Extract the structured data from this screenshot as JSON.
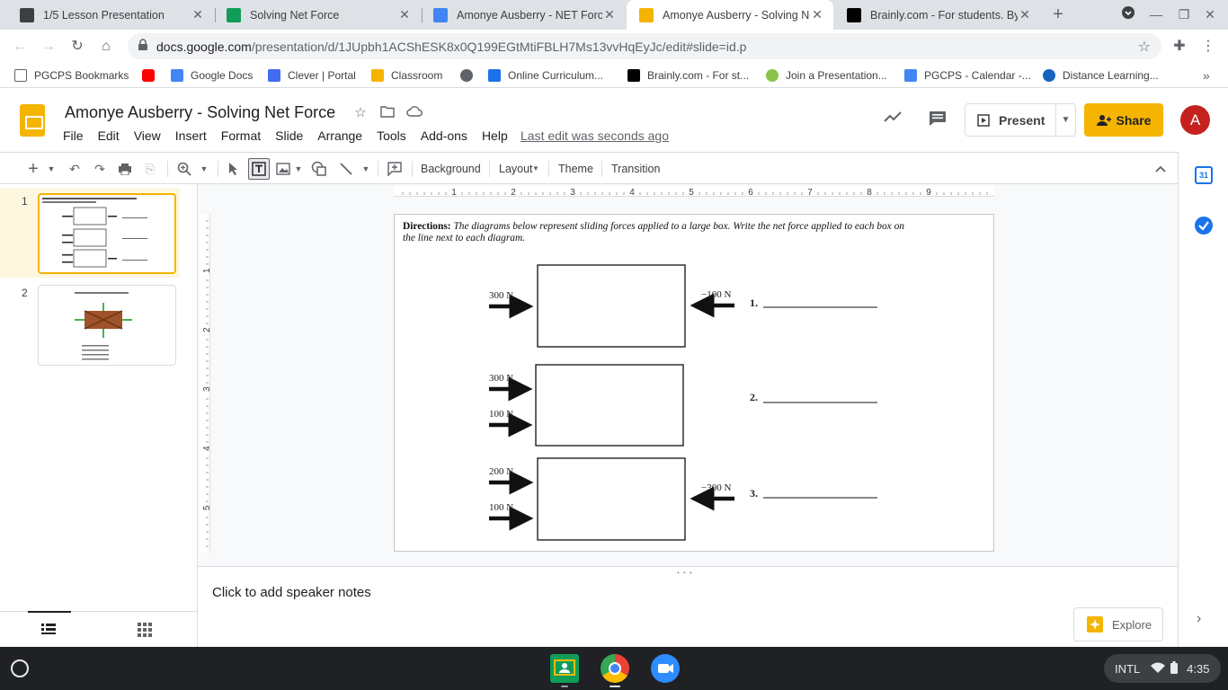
{
  "browser": {
    "tabs": [
      {
        "title": "1/5 Lesson Presentation",
        "color": "#3c4043"
      },
      {
        "title": "Solving Net Force",
        "color": "#0f9d58"
      },
      {
        "title": "Amonye Ausberry - NET Force",
        "color": "#4285f4"
      },
      {
        "title": "Amonye Ausberry - Solving Ne",
        "color": "#f4b400"
      },
      {
        "title": "Brainly.com - For students. By",
        "color": "#000000"
      }
    ],
    "url_host": "docs.google.com",
    "url_path": "/presentation/d/1JUpbh1ACShESK8x0Q199EGtMtiFBLH7Ms13vvHqEyJc/edit#slide=id.p",
    "bookmarks": [
      {
        "label": "PGCPS Bookmarks",
        "color": "#5f6368"
      },
      {
        "label": "",
        "color": "#ff0000"
      },
      {
        "label": "Google Docs",
        "color": "#4285f4"
      },
      {
        "label": "Clever | Portal",
        "color": "#436cf2"
      },
      {
        "label": "Classroom",
        "color": "#f4b400"
      },
      {
        "label": "",
        "color": "#5f6368"
      },
      {
        "label": "Online Curriculum...",
        "color": "#1a73e8"
      },
      {
        "label": "Brainly.com - For st...",
        "color": "#000000"
      },
      {
        "label": "Join a Presentation...",
        "color": "#8bc34a"
      },
      {
        "label": "PGCPS - Calendar -...",
        "color": "#4285f4"
      },
      {
        "label": "Distance Learning...",
        "color": "#1565c0"
      }
    ]
  },
  "app": {
    "doc_title": "Amonye Ausberry - Solving Net Force",
    "menu": [
      "File",
      "Edit",
      "View",
      "Insert",
      "Format",
      "Slide",
      "Arrange",
      "Tools",
      "Add-ons",
      "Help"
    ],
    "last_edit": "Last edit was seconds ago",
    "present_label": "Present",
    "share_label": "Share",
    "avatar_letter": "A"
  },
  "toolbar": {
    "background": "Background",
    "layout": "Layout",
    "theme": "Theme",
    "transition": "Transition"
  },
  "filmstrip": {
    "slides": [
      {
        "number": "1",
        "selected": true
      },
      {
        "number": "2",
        "selected": false
      }
    ]
  },
  "slide": {
    "directions_bold": "Directions:",
    "directions_text": "The diagrams below represent sliding forces applied to a large box. Write the net force applied to each box on the line next to each diagram.",
    "diagrams": [
      {
        "number": "1.",
        "left_forces": [
          "300 N"
        ],
        "right_force": "−100 N"
      },
      {
        "number": "2.",
        "left_forces": [
          "300 N",
          "100 N"
        ],
        "right_force": ""
      },
      {
        "number": "3.",
        "left_forces": [
          "200 N",
          "100 N"
        ],
        "right_force": "−300 N"
      }
    ]
  },
  "notes": {
    "placeholder": "Click to add speaker notes",
    "explore": "Explore"
  },
  "shelf": {
    "ime": "INTL",
    "time": "4:35"
  }
}
